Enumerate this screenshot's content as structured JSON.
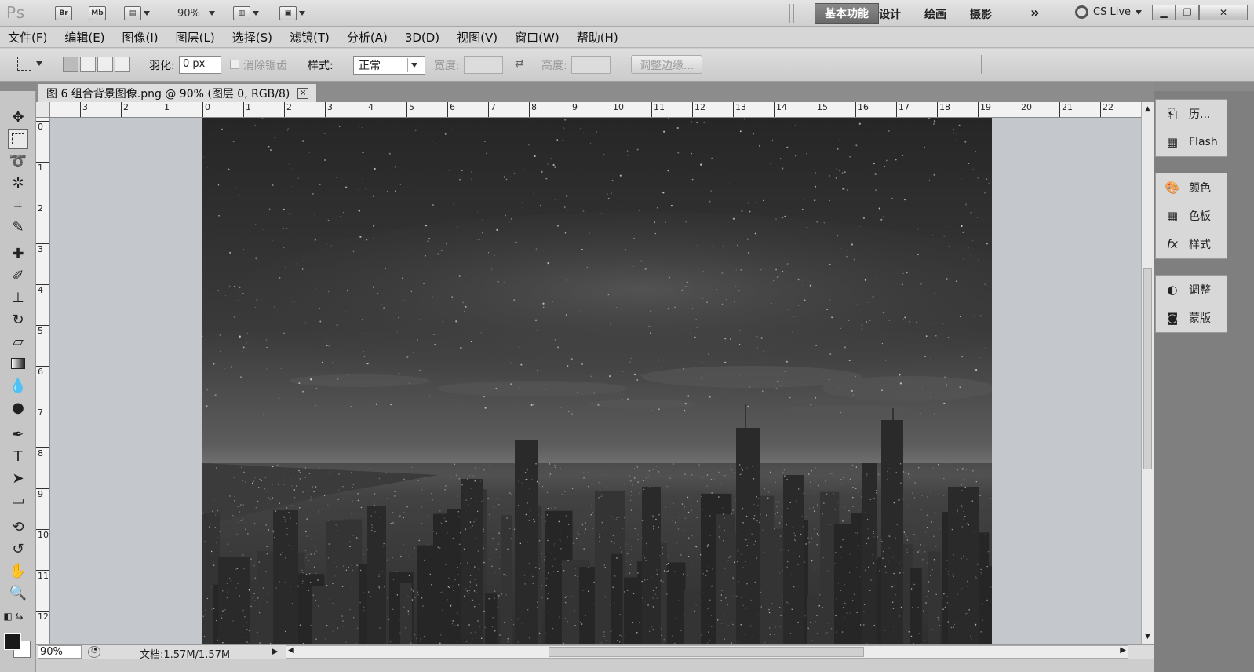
{
  "appbar": {
    "logo": "Ps",
    "br_label": "Br",
    "mb_label": "Mb",
    "zoom": "90%",
    "workspaces": [
      "基本功能",
      "设计",
      "绘画",
      "摄影"
    ],
    "more": "»",
    "cs_live": "CS Live"
  },
  "menus": [
    "文件(F)",
    "编辑(E)",
    "图像(I)",
    "图层(L)",
    "选择(S)",
    "滤镜(T)",
    "分析(A)",
    "3D(D)",
    "视图(V)",
    "窗口(W)",
    "帮助(H)"
  ],
  "options": {
    "feather_label": "羽化:",
    "feather_value": "0 px",
    "antialias_label": "消除锯齿",
    "style_label": "样式:",
    "style_value": "正常",
    "width_label": "宽度:",
    "height_label": "高度:",
    "refine_edge": "调整边缘..."
  },
  "document": {
    "tab_title": "图 6  组合背景图像.png @ 90% (图层 0, RGB/8)",
    "close": "×"
  },
  "ruler": {
    "h_labels": [
      "3",
      "2",
      "1",
      "0",
      "1",
      "2",
      "3",
      "4",
      "5",
      "6",
      "7",
      "8",
      "9",
      "10",
      "11",
      "12",
      "13",
      "14",
      "15",
      "16",
      "17",
      "18",
      "19",
      "20",
      "21",
      "22"
    ],
    "v_labels": [
      "0",
      "1",
      "2",
      "3",
      "4",
      "5",
      "6",
      "7",
      "8",
      "9",
      "10",
      "11",
      "12"
    ]
  },
  "status": {
    "zoom": "90%",
    "doc_info": "文档:1.57M/1.57M"
  },
  "panels": {
    "group1": [
      {
        "icon": "history-icon",
        "label": "历..."
      },
      {
        "icon": "flash-icon",
        "label": "Flash"
      }
    ],
    "group2": [
      {
        "icon": "color-icon",
        "label": "颜色"
      },
      {
        "icon": "swatches-icon",
        "label": "色板"
      },
      {
        "icon": "styles-icon",
        "label": "样式"
      }
    ],
    "group3": [
      {
        "icon": "adjustments-icon",
        "label": "调整"
      },
      {
        "icon": "masks-icon",
        "label": "蒙版"
      }
    ]
  },
  "colors": {
    "foreground": "#1a1a1a",
    "background": "#ffffff",
    "active_workspace": "#777777"
  }
}
